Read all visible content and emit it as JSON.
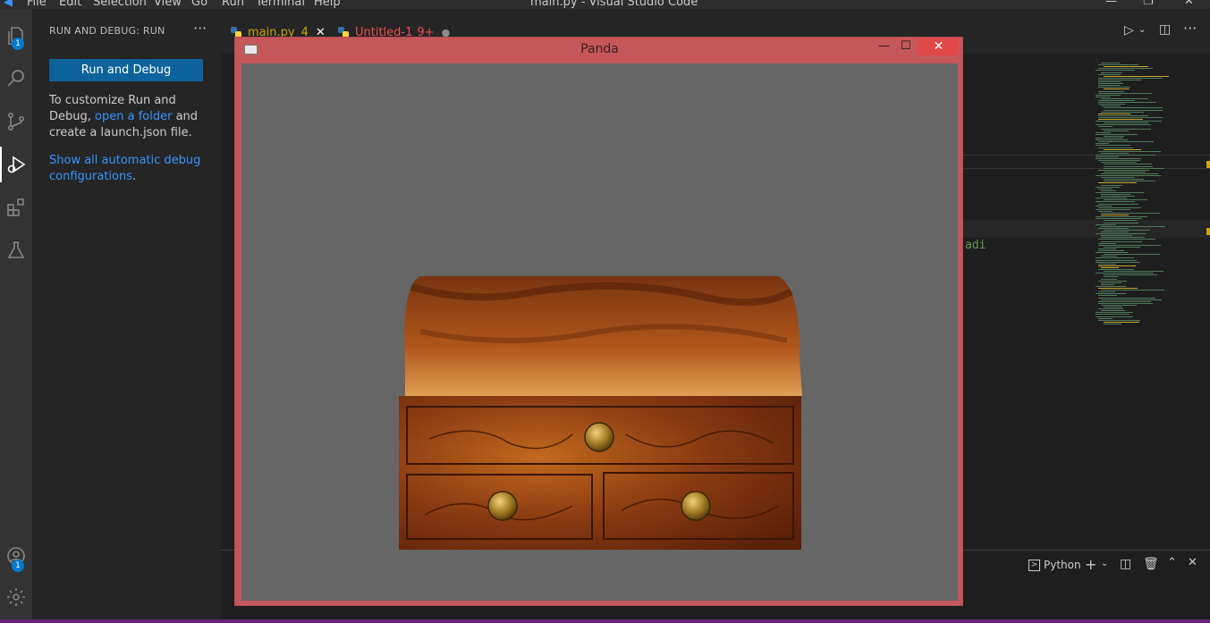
{
  "titlebar": {
    "menu": [
      "File",
      "Edit",
      "Selection",
      "View",
      "Go",
      "Run",
      "Terminal",
      "Help"
    ],
    "window_title": "main.py - Visual Studio Code"
  },
  "activity_bar": {
    "explorer_badge": "1",
    "accounts_badge": "1"
  },
  "sidebar": {
    "header": "RUN AND DEBUG: RUN",
    "more": "···",
    "run_button": "Run and Debug",
    "text1_a": "To customize Run and Debug, ",
    "text1_link": "open a folder",
    "text1_b": " and create a launch.json file.",
    "link2": "Show all automatic debug configurations",
    "link2_suffix": "."
  },
  "tabs": [
    {
      "label": "main.py",
      "problems": "4",
      "active": true
    },
    {
      "label": "Untitled-1",
      "problems": "9+",
      "active": false,
      "dirty": true
    }
  ],
  "editor": {
    "visible_fragment": "adi"
  },
  "panel": {
    "terminal_label": "Python"
  },
  "panda_window": {
    "title": "Panda",
    "minimize": "—",
    "maximize": "☐",
    "close": "✕"
  },
  "colors": {
    "accent": "#0e639c",
    "link": "#3794ff",
    "panda_frame": "#c5575a",
    "status": "#68217a"
  }
}
